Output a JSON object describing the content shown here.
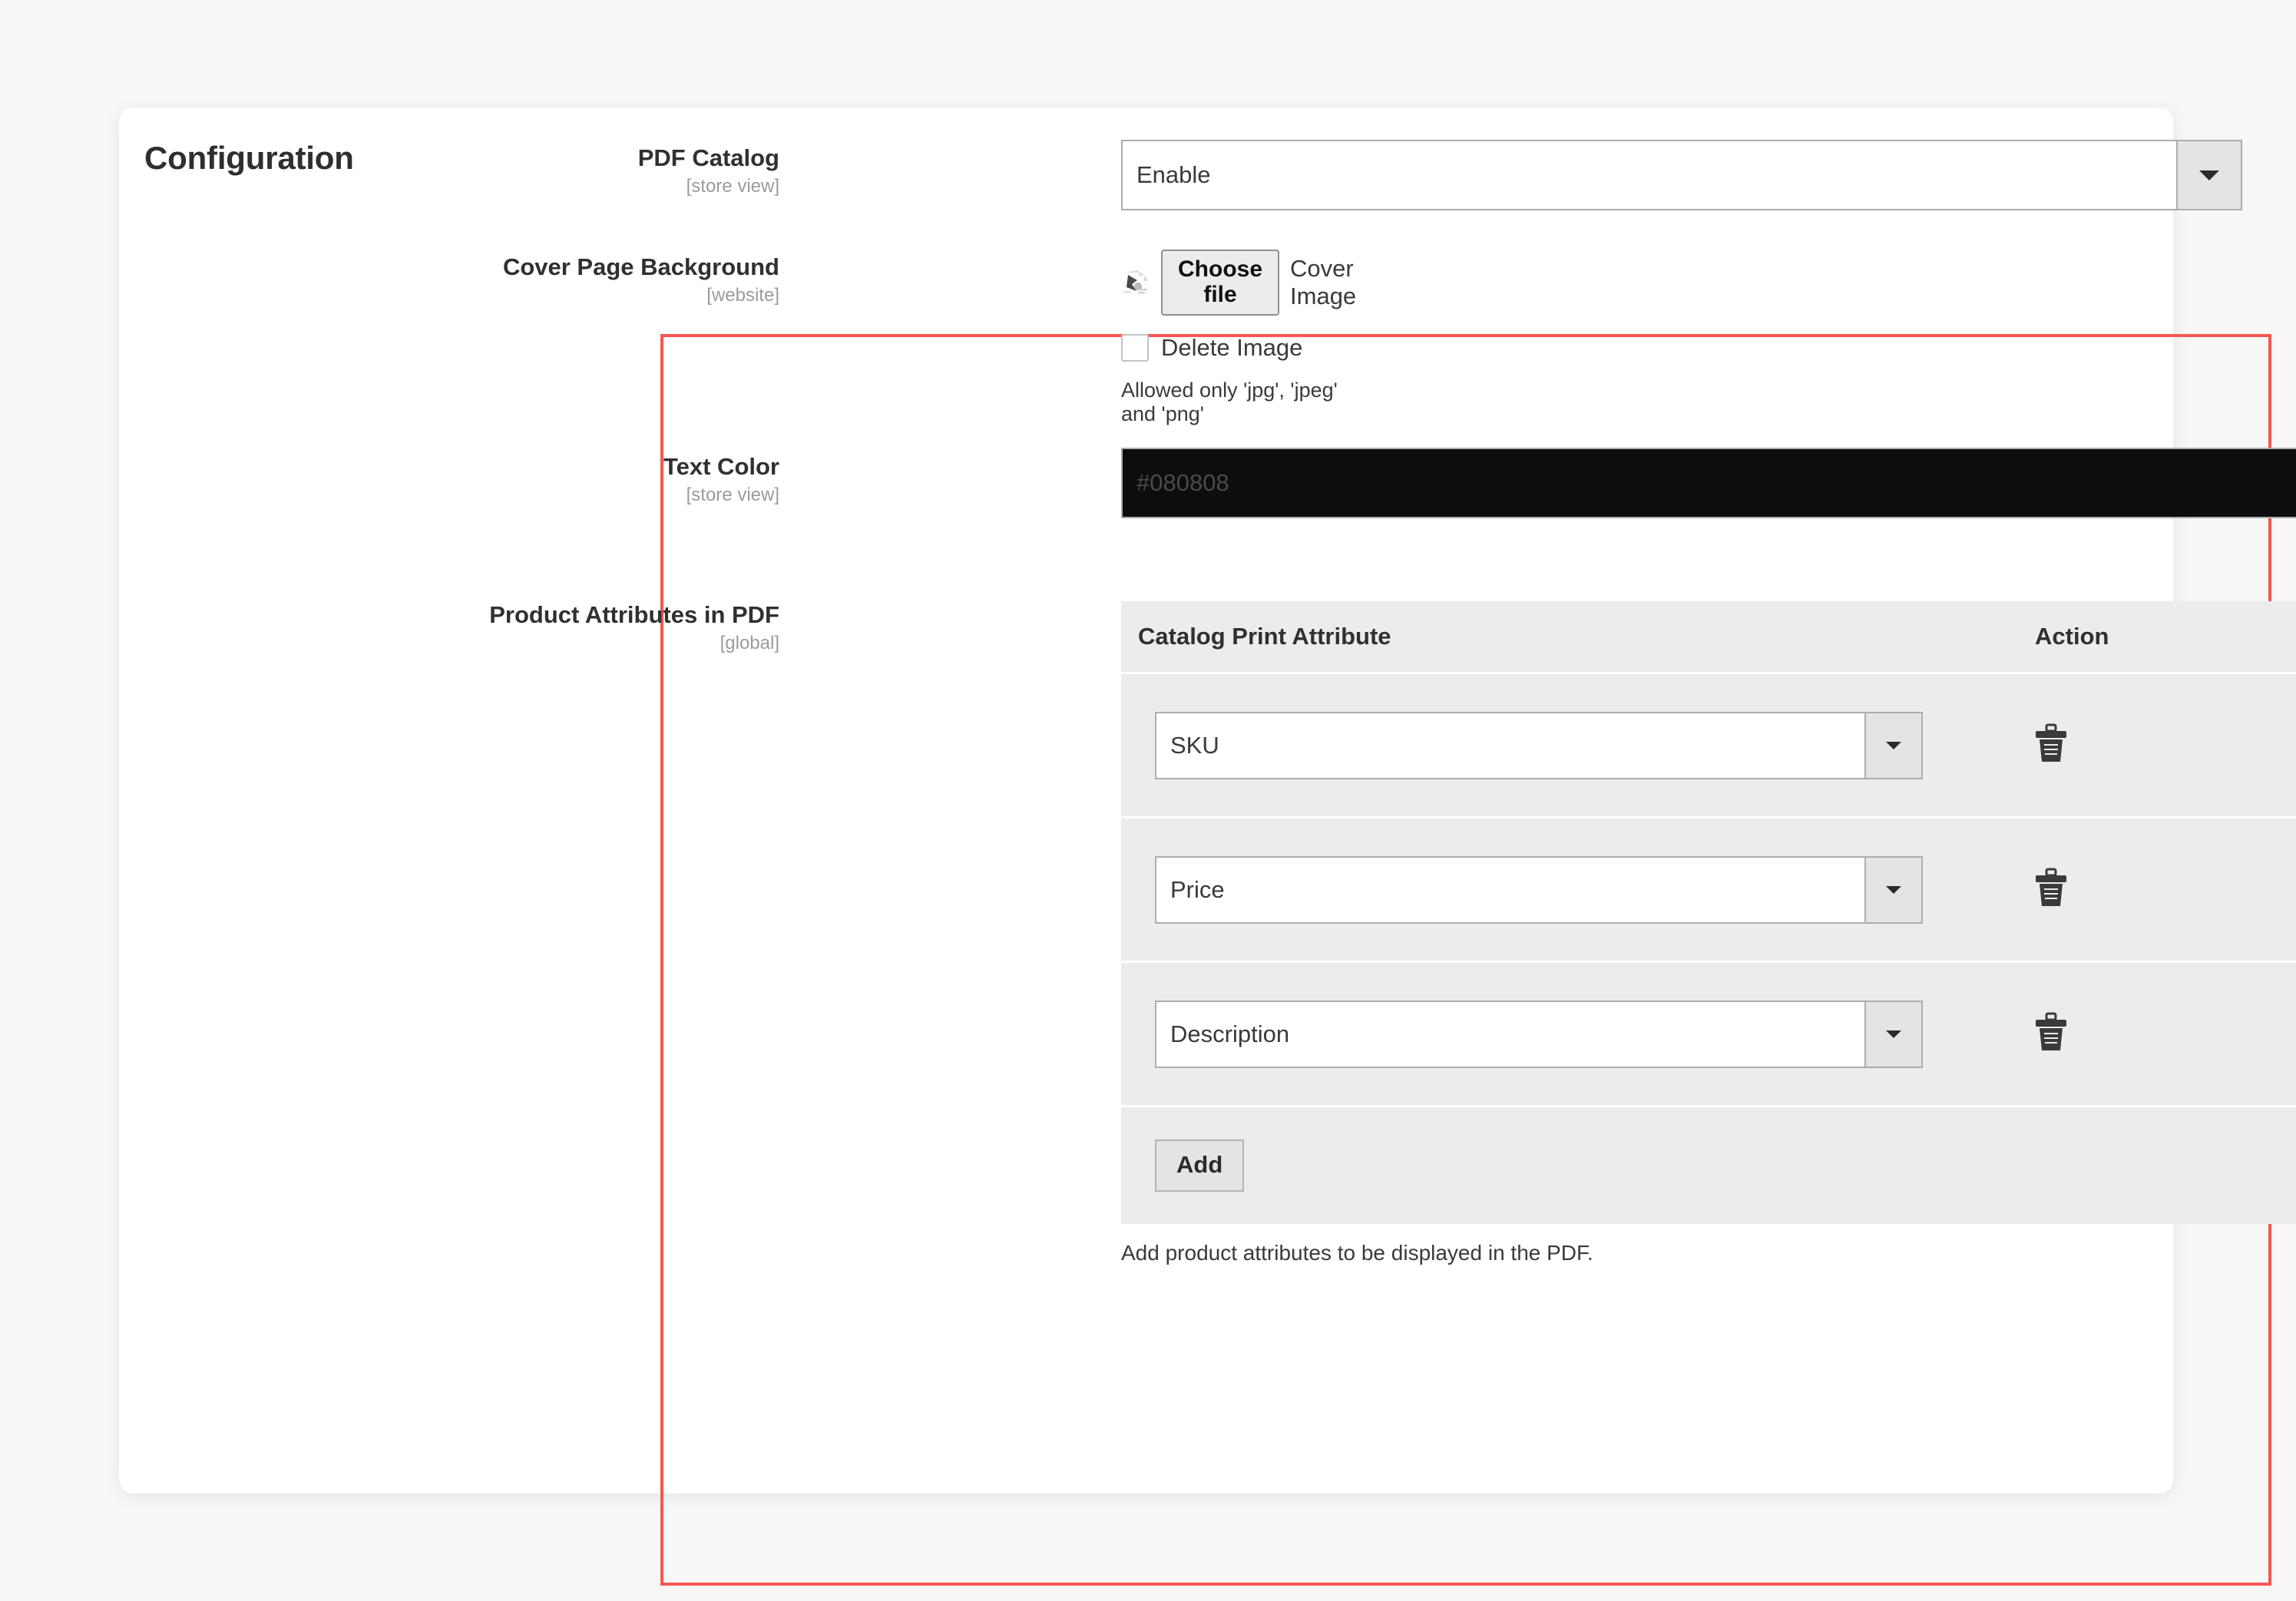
{
  "card": {
    "title": "Configuration"
  },
  "colors": {
    "highlight_border": "#f65751",
    "page_background": "#f7f7f7",
    "card_background": "#ffffff",
    "table_background": "#ececec",
    "color_field_fill": "#0d0d0d"
  },
  "fields": {
    "pdf_catalog": {
      "label": "PDF Catalog",
      "scope": "[store view]",
      "value": "Enable"
    },
    "cover_page_background": {
      "label": "Cover Page Background",
      "scope": "[website]",
      "choose_file_label": "Choose file",
      "file_name": "Cover Image",
      "delete_checkbox_label": "Delete Image",
      "delete_checked": false,
      "note": "Allowed only 'jpg', 'jpeg' and 'png'"
    },
    "text_color": {
      "label": "Text Color",
      "scope": "[store view]",
      "value": "#080808"
    },
    "product_attributes": {
      "label": "Product Attributes in PDF",
      "scope": "[global]",
      "columns": [
        "Catalog Print Attribute",
        "Action"
      ],
      "rows": [
        {
          "attribute": "SKU"
        },
        {
          "attribute": "Price"
        },
        {
          "attribute": "Description"
        }
      ],
      "add_label": "Add",
      "note": "Add product attributes to be displayed in the PDF."
    }
  },
  "icons": {
    "dropdown": "chevron-down-icon",
    "delete_row": "trash-icon",
    "broken_image": "broken-image-icon"
  }
}
